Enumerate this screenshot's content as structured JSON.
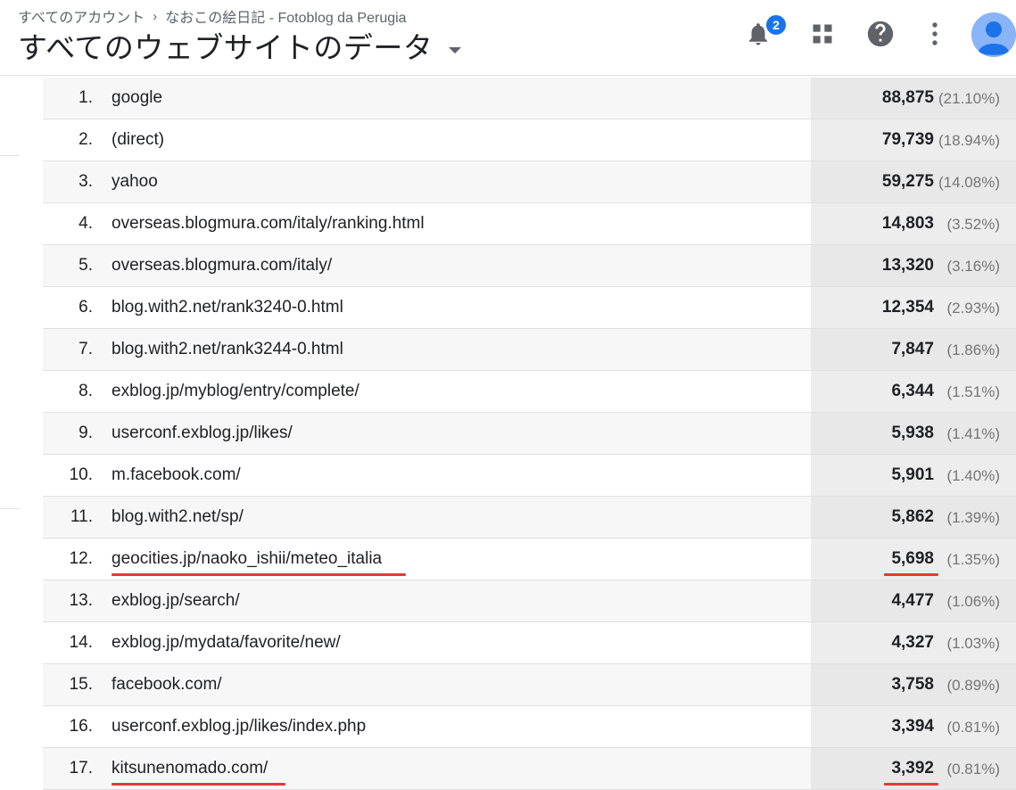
{
  "header": {
    "breadcrumb": [
      "すべてのアカウント",
      "なおこの絵日記 - Fotoblog da Perugia"
    ],
    "breadcrumb_separator": "›",
    "title": "すべてのウェブサイトのデータ",
    "notification_count": "2",
    "icons": [
      "bell-icon",
      "apps-grid-icon",
      "help-icon",
      "more-vert-icon",
      "avatar"
    ]
  },
  "colors": {
    "accent": "#1a73e8",
    "highlight_underline": "#e53935",
    "row_alt": "#f7f7f7",
    "value_column": "#ededed"
  },
  "table": {
    "rows": [
      {
        "rank": "1.",
        "source": "google",
        "value": "88,875",
        "pct": "(21.10%)"
      },
      {
        "rank": "2.",
        "source": "(direct)",
        "value": "79,739",
        "pct": "(18.94%)"
      },
      {
        "rank": "3.",
        "source": "yahoo",
        "value": "59,275",
        "pct": "(14.08%)"
      },
      {
        "rank": "4.",
        "source": "overseas.blogmura.com/italy/ranking.html",
        "value": "14,803",
        "pct": "(3.52%)"
      },
      {
        "rank": "5.",
        "source": "overseas.blogmura.com/italy/",
        "value": "13,320",
        "pct": "(3.16%)"
      },
      {
        "rank": "6.",
        "source": "blog.with2.net/rank3240-0.html",
        "value": "12,354",
        "pct": "(2.93%)"
      },
      {
        "rank": "7.",
        "source": "blog.with2.net/rank3244-0.html",
        "value": "7,847",
        "pct": "(1.86%)"
      },
      {
        "rank": "8.",
        "source": "exblog.jp/myblog/entry/complete/",
        "value": "6,344",
        "pct": "(1.51%)"
      },
      {
        "rank": "9.",
        "source": "userconf.exblog.jp/likes/",
        "value": "5,938",
        "pct": "(1.41%)"
      },
      {
        "rank": "10.",
        "source": "m.facebook.com/",
        "value": "5,901",
        "pct": "(1.40%)"
      },
      {
        "rank": "11.",
        "source": "blog.with2.net/sp/",
        "value": "5,862",
        "pct": "(1.39%)"
      },
      {
        "rank": "12.",
        "source": "geocities.jp/naoko_ishii/meteo_italia",
        "value": "5,698",
        "pct": "(1.35%)",
        "highlighted": true
      },
      {
        "rank": "13.",
        "source": "exblog.jp/search/",
        "value": "4,477",
        "pct": "(1.06%)"
      },
      {
        "rank": "14.",
        "source": "exblog.jp/mydata/favorite/new/",
        "value": "4,327",
        "pct": "(1.03%)"
      },
      {
        "rank": "15.",
        "source": "facebook.com/",
        "value": "3,758",
        "pct": "(0.89%)"
      },
      {
        "rank": "16.",
        "source": "userconf.exblog.jp/likes/index.php",
        "value": "3,394",
        "pct": "(0.81%)"
      },
      {
        "rank": "17.",
        "source": "kitsunenomado.com/",
        "value": "3,392",
        "pct": "(0.81%)",
        "highlighted": true
      }
    ]
  }
}
